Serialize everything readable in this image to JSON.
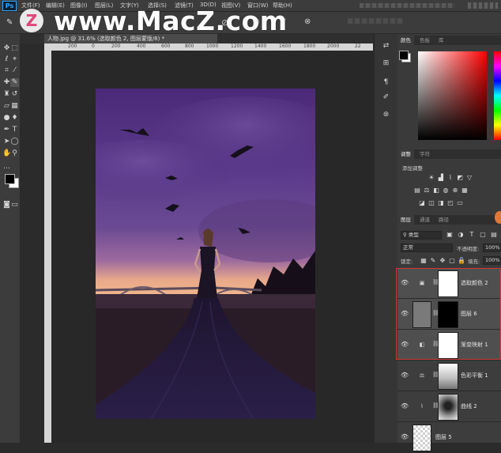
{
  "app": {
    "logo": "Ps"
  },
  "menu": [
    "文件(F)",
    "编辑(E)",
    "图像(I)",
    "图层(L)",
    "文字(Y)",
    "选择(S)",
    "滤镜(T)",
    "3D(D)",
    "视图(V)",
    "窗口(W)",
    "帮助(H)"
  ],
  "watermark": {
    "logo_letter": "Z",
    "text": "www.MacZ.com"
  },
  "document": {
    "tab_title": "人物.jpg @ 31.6% (选取颜色 2, 图层蒙版/8) *",
    "ruler_ticks": [
      "200",
      "0",
      "200",
      "400",
      "600",
      "800",
      "1000",
      "1200",
      "1400",
      "1600",
      "1800",
      "2000",
      "22"
    ]
  },
  "panels": {
    "color": {
      "tabs": [
        "颜色",
        "色板",
        "库"
      ]
    },
    "adjustments": {
      "tabs": [
        "调整",
        "字符"
      ],
      "title": "添加调整"
    },
    "layers": {
      "tabs": [
        "图层",
        "通道",
        "路径"
      ],
      "filter_kind": "类型",
      "blend_mode": "正常",
      "opacity_label": "不透明度:",
      "opacity_value": "100%",
      "lock_label": "锁定:",
      "fill_label": "填充:",
      "fill_value": "100%",
      "items": [
        {
          "name": "选取颜色 2",
          "selected": true,
          "icon": "selective-color-icon"
        },
        {
          "name": "图层 6",
          "selected": true,
          "icon": ""
        },
        {
          "name": "渐变映射 1",
          "selected": true,
          "icon": "gradient-map-icon"
        },
        {
          "name": "色彩平衡 1",
          "selected": false,
          "icon": "color-balance-icon"
        },
        {
          "name": "曲线 2",
          "selected": false,
          "icon": "curves-icon"
        },
        {
          "name": "图层 5",
          "selected": false,
          "icon": ""
        }
      ]
    }
  },
  "colors": {
    "accent_selection": "#cc3a3a",
    "ps_blue": "#31a8ff",
    "panel_bg": "#3a3a3a"
  }
}
